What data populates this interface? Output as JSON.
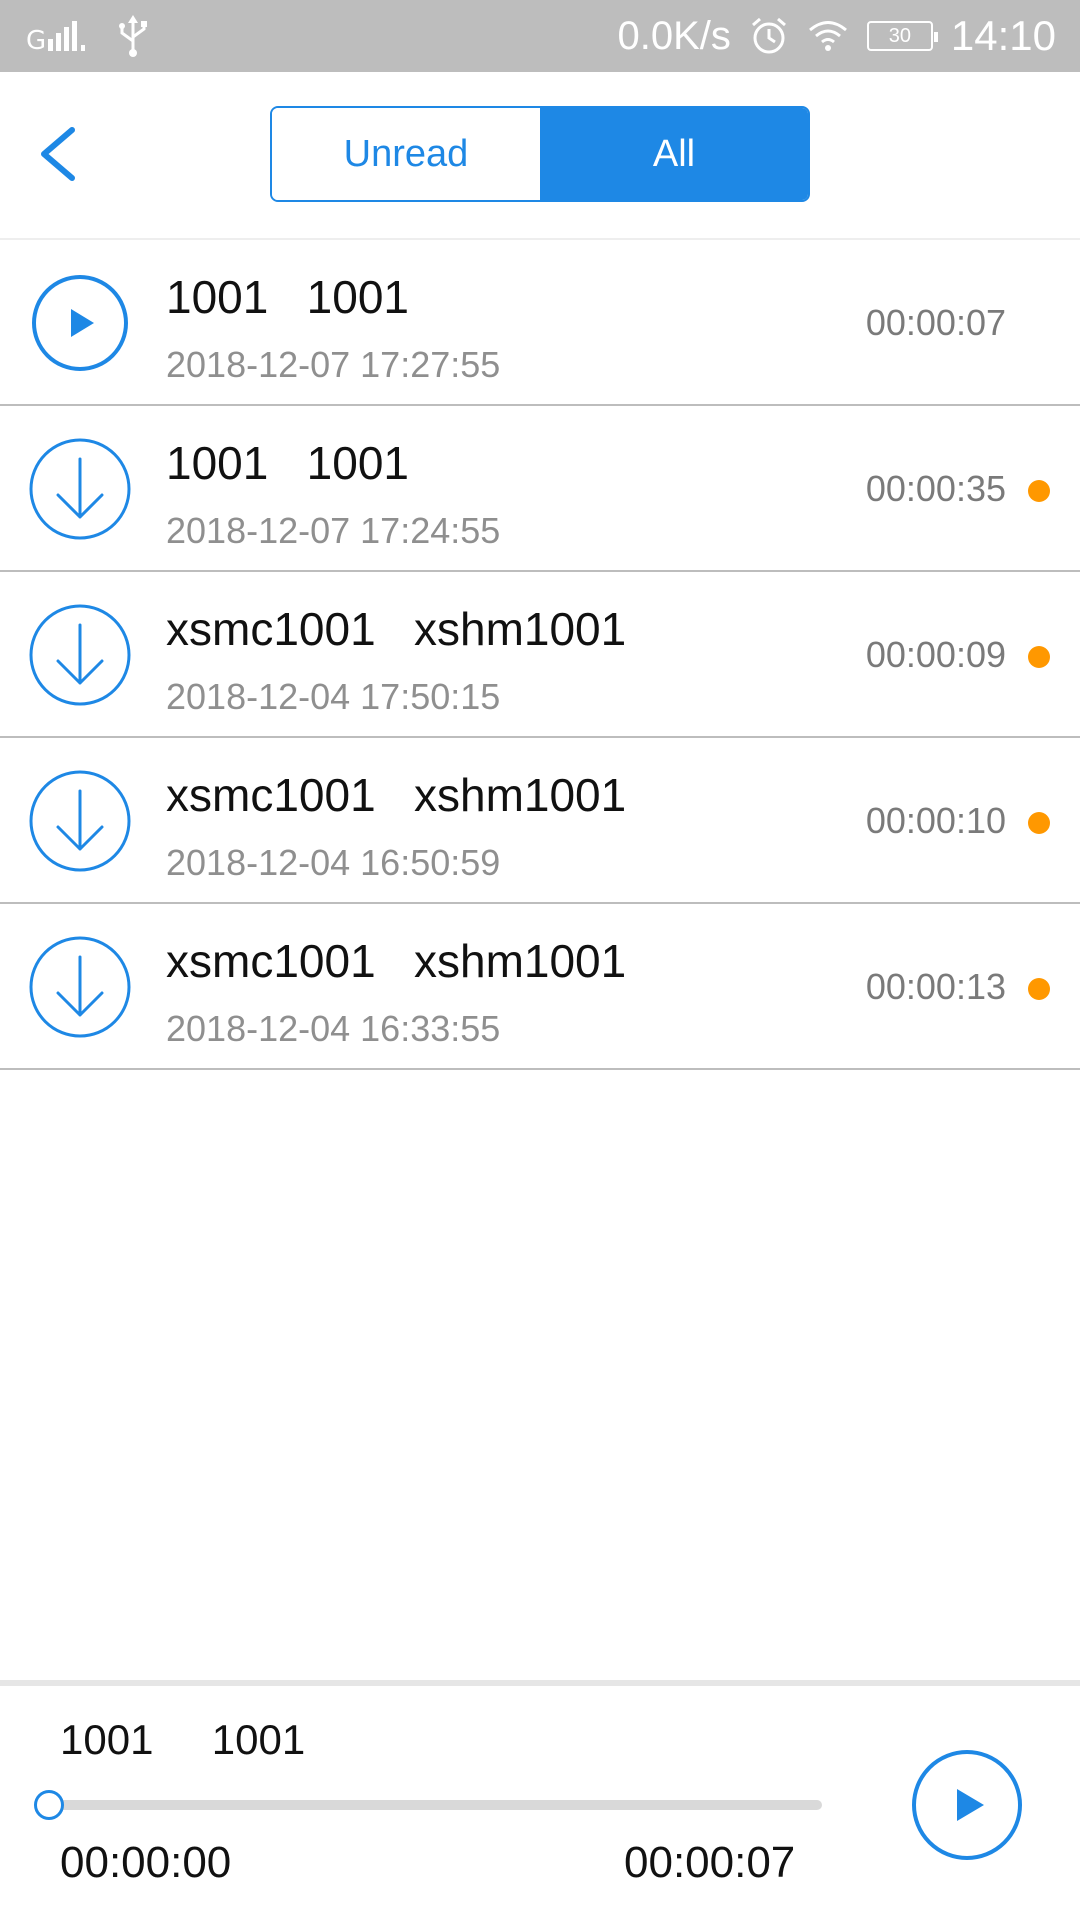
{
  "status_bar": {
    "signal_icon": "signal-icon",
    "usb_icon": "usb-icon",
    "speed": "0.0K/s",
    "alarm_icon": "alarm-icon",
    "wifi_icon": "wifi-icon",
    "battery": "30",
    "time": "14:10"
  },
  "header": {
    "back_icon": "chevron-left-icon",
    "tabs": [
      {
        "label": "Unread",
        "active": false
      },
      {
        "label": "All",
        "active": true
      }
    ]
  },
  "recordings": [
    {
      "title": "1001   1001",
      "date": "2018-12-07 17:27:55",
      "duration": "00:00:07",
      "icon": "play-icon",
      "unread": false
    },
    {
      "title": "1001   1001",
      "date": "2018-12-07 17:24:55",
      "duration": "00:00:35",
      "icon": "download-icon",
      "unread": true
    },
    {
      "title": "xsmc1001   xshm1001",
      "date": "2018-12-04 17:50:15",
      "duration": "00:00:09",
      "icon": "download-icon",
      "unread": true
    },
    {
      "title": "xsmc1001   xshm1001",
      "date": "2018-12-04 16:50:59",
      "duration": "00:00:10",
      "icon": "download-icon",
      "unread": true
    },
    {
      "title": "xsmc1001   xshm1001",
      "date": "2018-12-04 16:33:55",
      "duration": "00:00:13",
      "icon": "download-icon",
      "unread": true
    }
  ],
  "player": {
    "title": "1001     1001",
    "current_time": "00:00:00",
    "total_time": "00:00:07",
    "progress": 0,
    "play_icon": "play-icon"
  },
  "colors": {
    "accent": "#1e88e5",
    "unread_dot": "#ff9800",
    "status_bar": "#bdbdbd"
  }
}
